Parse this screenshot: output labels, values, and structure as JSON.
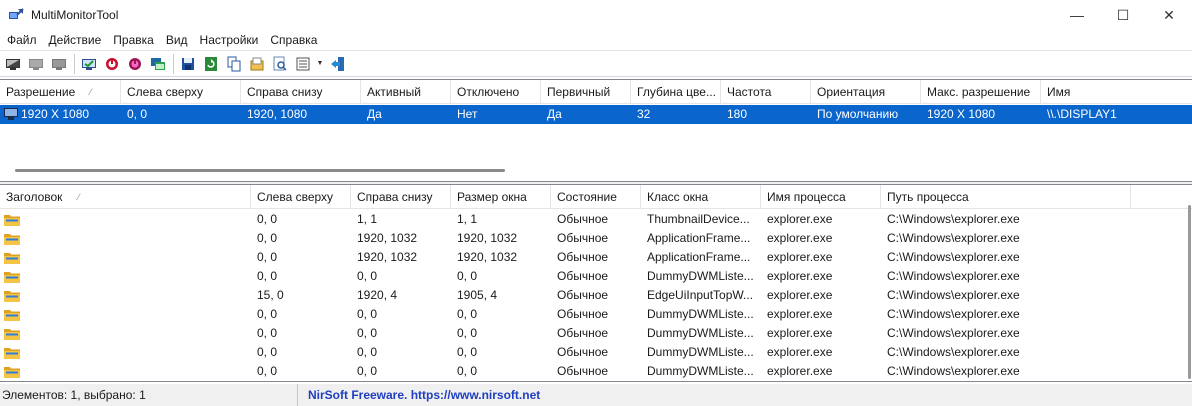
{
  "window": {
    "title": "MultiMonitorTool",
    "minimize": "—",
    "maximize": "☐",
    "close": "✕"
  },
  "menu": [
    "Файл",
    "Действие",
    "Правка",
    "Вид",
    "Настройки",
    "Справка"
  ],
  "toolbar": {
    "icons": [
      "disable-monitor-icon",
      "enable-monitor-icon",
      "switch-monitor-icon",
      "set-primary-icon",
      "turn-off-icon",
      "turn-on-icon",
      "move-window-icon",
      "save-icon",
      "refresh-icon",
      "copy-icon",
      "properties-icon",
      "find-icon",
      "view-options-icon",
      "exit-icon"
    ]
  },
  "monitors": {
    "columns": [
      "Разрешение",
      "Слева сверху",
      "Справа снизу",
      "Активный",
      "Отключено",
      "Первичный",
      "Глубина цве...",
      "Частота",
      "Ориентация",
      "Макс. разрешение",
      "Имя"
    ],
    "sort_indicator": "⁄",
    "rows": [
      [
        "1920 X 1080",
        "0, 0",
        "1920, 1080",
        "Да",
        "Нет",
        "Да",
        "32",
        "180",
        "По умолчанию",
        "1920 X 1080",
        "\\\\.\\DISPLAY1"
      ]
    ]
  },
  "windows": {
    "columns": [
      "Заголовок",
      "Слева сверху",
      "Справа снизу",
      "Размер окна",
      "Состояние",
      "Класс окна",
      "Имя процесса",
      "Путь процесса"
    ],
    "sort_indicator": "⁄",
    "rows": [
      [
        "",
        "0, 0",
        "1, 1",
        "1, 1",
        "Обычное",
        "ThumbnailDevice...",
        "explorer.exe",
        "C:\\Windows\\explorer.exe"
      ],
      [
        "",
        "0, 0",
        "1920, 1032",
        "1920, 1032",
        "Обычное",
        "ApplicationFrame...",
        "explorer.exe",
        "C:\\Windows\\explorer.exe"
      ],
      [
        "",
        "0, 0",
        "1920, 1032",
        "1920, 1032",
        "Обычное",
        "ApplicationFrame...",
        "explorer.exe",
        "C:\\Windows\\explorer.exe"
      ],
      [
        "",
        "0, 0",
        "0, 0",
        "0, 0",
        "Обычное",
        "DummyDWMListe...",
        "explorer.exe",
        "C:\\Windows\\explorer.exe"
      ],
      [
        "",
        "15, 0",
        "1920, 4",
        "1905, 4",
        "Обычное",
        "EdgeUiInputTopW...",
        "explorer.exe",
        "C:\\Windows\\explorer.exe"
      ],
      [
        "",
        "0, 0",
        "0, 0",
        "0, 0",
        "Обычное",
        "DummyDWMListe...",
        "explorer.exe",
        "C:\\Windows\\explorer.exe"
      ],
      [
        "",
        "0, 0",
        "0, 0",
        "0, 0",
        "Обычное",
        "DummyDWMListe...",
        "explorer.exe",
        "C:\\Windows\\explorer.exe"
      ],
      [
        "",
        "0, 0",
        "0, 0",
        "0, 0",
        "Обычное",
        "DummyDWMListe...",
        "explorer.exe",
        "C:\\Windows\\explorer.exe"
      ],
      [
        "",
        "0, 0",
        "0, 0",
        "0, 0",
        "Обычное",
        "DummyDWMListe...",
        "explorer.exe",
        "C:\\Windows\\explorer.exe"
      ]
    ]
  },
  "status": {
    "items": "Элементов: 1, выбрано: 1",
    "link": "NirSoft Freeware. https://www.nirsoft.net"
  },
  "colors": {
    "selection": "#0a66cc",
    "link": "#1f3fbf",
    "folder": "#f2b632"
  }
}
